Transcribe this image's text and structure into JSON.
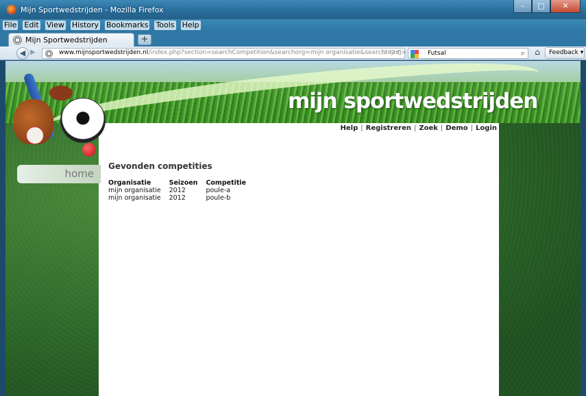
{
  "window": {
    "title": "Mijn Sportwedstrijden - Mozilla Firefox",
    "controls": [
      "minimize",
      "maximize",
      "close"
    ]
  },
  "menubar": {
    "items": [
      "File",
      "Edit",
      "View",
      "History",
      "Bookmarks",
      "Tools",
      "Help"
    ]
  },
  "tabs": [
    {
      "label": "Mijn Sportwedstrijden",
      "icon": "soccer-ball-icon"
    }
  ],
  "newtab_label": "+",
  "navigation": {
    "back_symbol": "◀",
    "forward_symbol": "▶",
    "url_domain": "www.mijnsportwedstrijden.nl",
    "url_rest": "/index.php?section=searchCompetition&searchorg=mijn organisatie&searchteam=",
    "url_icons": "☆ ▽ C",
    "search_engine_icon": "google-icon",
    "search_value": "Futsal",
    "home_symbol": "⌂",
    "feedback_label": "Feedback ▾"
  },
  "site": {
    "brand": "mijn sportwedstrijden",
    "nav": [
      "Help",
      "Registreren",
      "Zoek",
      "Demo",
      "Login"
    ],
    "sidebar_home": "home"
  },
  "main": {
    "title": "Gevonden competities",
    "table": {
      "headers": [
        "Organisatie",
        "Seizoen",
        "Competitie"
      ],
      "rows": [
        [
          "mijn organisatie",
          "2012",
          "poule-a"
        ],
        [
          "mijn organisatie",
          "2012",
          "poule-b"
        ]
      ]
    }
  }
}
